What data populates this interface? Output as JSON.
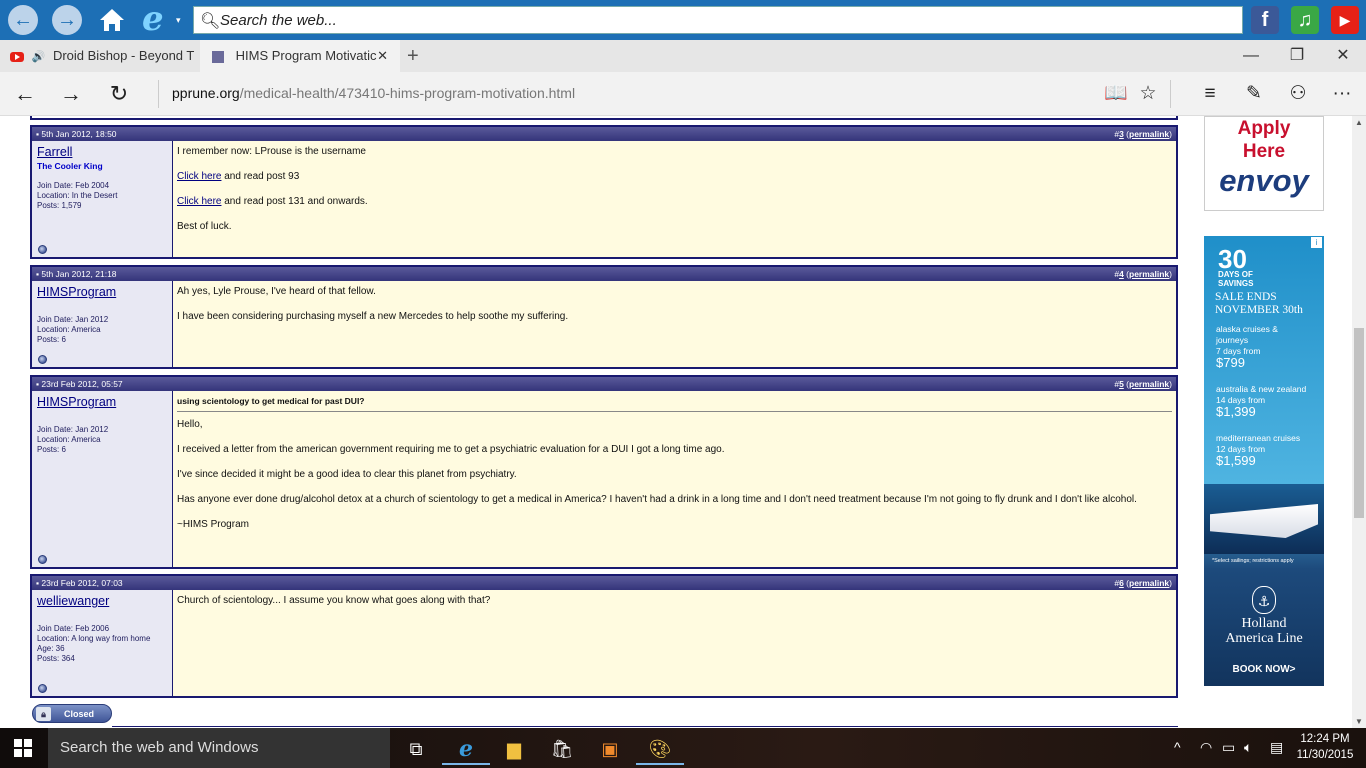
{
  "launcher": {
    "search_placeholder": "Search the web...",
    "back_glyph": "←",
    "forward_glyph": "→",
    "ie_glyph": "e",
    "caret_glyph": "▾",
    "facebook_glyph": "f",
    "music_glyph": "♫",
    "youtube_glyph": "▶"
  },
  "tabs": [
    {
      "title": "Droid Bishop - Beyond T",
      "audio_glyph": "🔊"
    },
    {
      "title": "HIMS Program Motivatic",
      "close_glyph": "✕"
    }
  ],
  "new_tab_glyph": "+",
  "window_controls": {
    "minimize": "—",
    "restore": "❐",
    "close": "✕"
  },
  "address": {
    "domain": "pprune.org",
    "path": "/medical-health/473410-hims-program-motivation.html",
    "back": "←",
    "forward": "→",
    "refresh": "↻",
    "reading_view": "📖",
    "favorite": "☆",
    "hub": "≡",
    "note": "✎",
    "share": "⚇",
    "more": "···"
  },
  "posts": [
    {
      "date": "5th Jan 2012, 18:50",
      "index": "3",
      "permalink": "permalink",
      "username": "Farrell",
      "user_title": "The Cooler King",
      "info": [
        "Join Date: Feb 2004",
        "Location: In the Desert",
        "Posts: 1,579"
      ],
      "lines": [
        {
          "text": "I remember now: LProuse is the username"
        },
        {
          "link": "Click here",
          "text": " and read post 93"
        },
        {
          "link": "Click here",
          "text": " and read post 131 and onwards."
        },
        {
          "text": "Best of luck."
        }
      ]
    },
    {
      "date": "5th Jan 2012, 21:18",
      "index": "4",
      "permalink": "permalink",
      "username": "HIMSProgram",
      "user_title": "",
      "info": [
        "Join Date: Jan 2012",
        "Location: America",
        "Posts: 6"
      ],
      "lines": [
        {
          "text": "Ah yes, Lyle Prouse, I've heard of that fellow."
        },
        {
          "text": "I have been considering purchasing myself a new Mercedes to help soothe my suffering."
        }
      ]
    },
    {
      "date": "23rd Feb 2012, 05:57",
      "index": "5",
      "permalink": "permalink",
      "username": "HIMSProgram",
      "user_title": "",
      "info": [
        "Join Date: Jan 2012",
        "Location: America",
        "Posts: 6"
      ],
      "title": "using scientology to get medical for past DUI?",
      "lines": [
        {
          "text": "Hello,"
        },
        {
          "text": "I received a letter from the american government requiring me to get a psychiatric evaluation for a DUI I got a long time ago."
        },
        {
          "text": "I've since decided it might be a good idea to clear this planet from psychiatry."
        },
        {
          "text": "Has anyone ever done drug/alcohol detox at a church of scientology to get a medical in America? I haven't had a drink in a long time and I don't need treatment because I'm not going to fly drunk and I don't like alcohol."
        },
        {
          "text": "~HIMS Program"
        }
      ]
    },
    {
      "date": "23rd Feb 2012, 07:03",
      "index": "6",
      "permalink": "permalink",
      "username": "welliewanger",
      "user_title": "",
      "info": [
        "Join Date: Feb 2006",
        "Location: A long way from home",
        "Age: 36",
        "Posts: 364"
      ],
      "lines": [
        {
          "text": "Church of scientology... I assume you know what goes along with that?"
        }
      ]
    }
  ],
  "closed_label": "Closed",
  "ads": {
    "envoy": {
      "line1": "Apply",
      "line2": "Here",
      "brand": "envoy"
    },
    "holland": {
      "big": "30",
      "days": [
        "DAYS OF",
        "SAVINGS"
      ],
      "sale": [
        "SALE ENDS",
        "NOVEMBER 30th"
      ],
      "deals": [
        {
          "dest": "alaska cruises &",
          "dest2": "journeys",
          "days": "7 days from",
          "price": "$799"
        },
        {
          "dest": "australia & new zealand",
          "dest2": "",
          "days": "14 days from",
          "price": "$1,399"
        },
        {
          "dest": "mediterranean cruises",
          "dest2": "",
          "days": "12 days from",
          "price": "$1,599"
        }
      ],
      "fine_print": "*Select sailings; restrictions apply",
      "name": [
        "Holland",
        "America Line"
      ],
      "cta": "BOOK NOW>",
      "info_icon": "i"
    }
  },
  "taskbar": {
    "search": "Search the web and Windows",
    "time": "12:24 PM",
    "date": "11/30/2015"
  }
}
